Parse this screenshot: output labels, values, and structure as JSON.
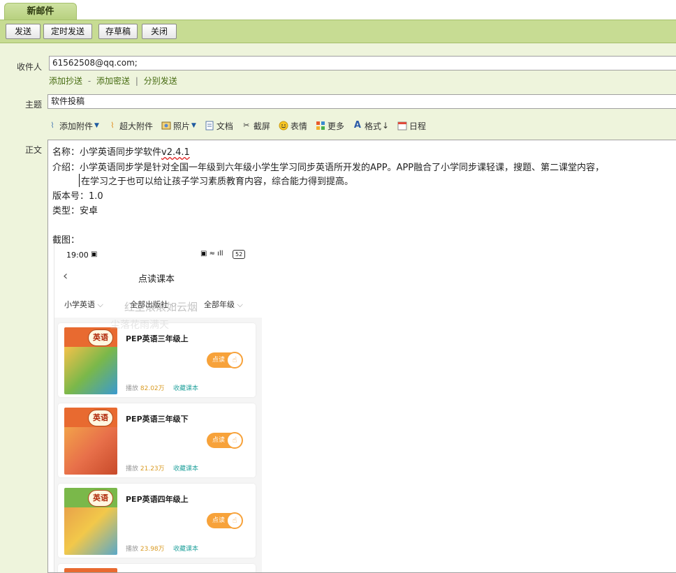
{
  "window": {
    "tab_title": "新邮件"
  },
  "toolbar": {
    "send": "发送",
    "scheduled_send": "定时发送",
    "save_draft": "存草稿",
    "close": "关闭"
  },
  "form": {
    "to_label": "收件人",
    "to_value": "61562508@qq.com;",
    "add_cc": "添加抄送",
    "dash": "-",
    "add_bcc": "添加密送",
    "pipe": "|",
    "separate_send": "分别发送",
    "subject_label": "主题",
    "subject_value": "软件投稿",
    "body_label": "正文"
  },
  "editor_toolbar": {
    "attach": "添加附件",
    "big_attach": "超大附件",
    "photo": "照片",
    "doc": "文档",
    "screenshot": "截屏",
    "emoji": "表情",
    "more": "更多",
    "format": "格式",
    "schedule": "日程"
  },
  "body": {
    "name_prefix": "名称：小学英语同步学软件",
    "name_version": "v2.4.1",
    "intro_line1": "介绍：小学英语同步学是针对全国一年级到六年级小学生学习同步英语所开发的APP。APP融合了小学同步课轻课，搜题、第二课堂内容，",
    "intro_line2": "在学习之于也可以给让孩子学习素质教育内容，综合能力得到提高。",
    "version_line": "版本号：1.0",
    "type_line": "类型：安卓",
    "screenshot_label": "截图："
  },
  "phone": {
    "time": "19:00",
    "battery": "52",
    "nav_title": "点读课本",
    "filters": [
      "小学英语",
      "全部出版社",
      "全部年级"
    ],
    "watermark1": "红尘滚滚如云烟",
    "watermark2": "尘落花雨满天",
    "books": [
      {
        "cover_text": "英语",
        "title": "PEP英语三年级上",
        "play_label": "播放",
        "plays": "82.02万",
        "fav": "收藏课本",
        "btn": "点读"
      },
      {
        "cover_text": "英语",
        "title": "PEP英语三年级下",
        "play_label": "播放",
        "plays": "21.23万",
        "fav": "收藏课本",
        "btn": "点读"
      },
      {
        "cover_text": "英语",
        "title": "PEP英语四年级上",
        "play_label": "播放",
        "plays": "23.98万",
        "fav": "收藏课本",
        "btn": "点读"
      }
    ]
  },
  "colors": {
    "toolbar_bg": "#c7dc93",
    "form_bg": "#eef4dc",
    "link": "#466b11",
    "accent_orange": "#f7a23a"
  }
}
